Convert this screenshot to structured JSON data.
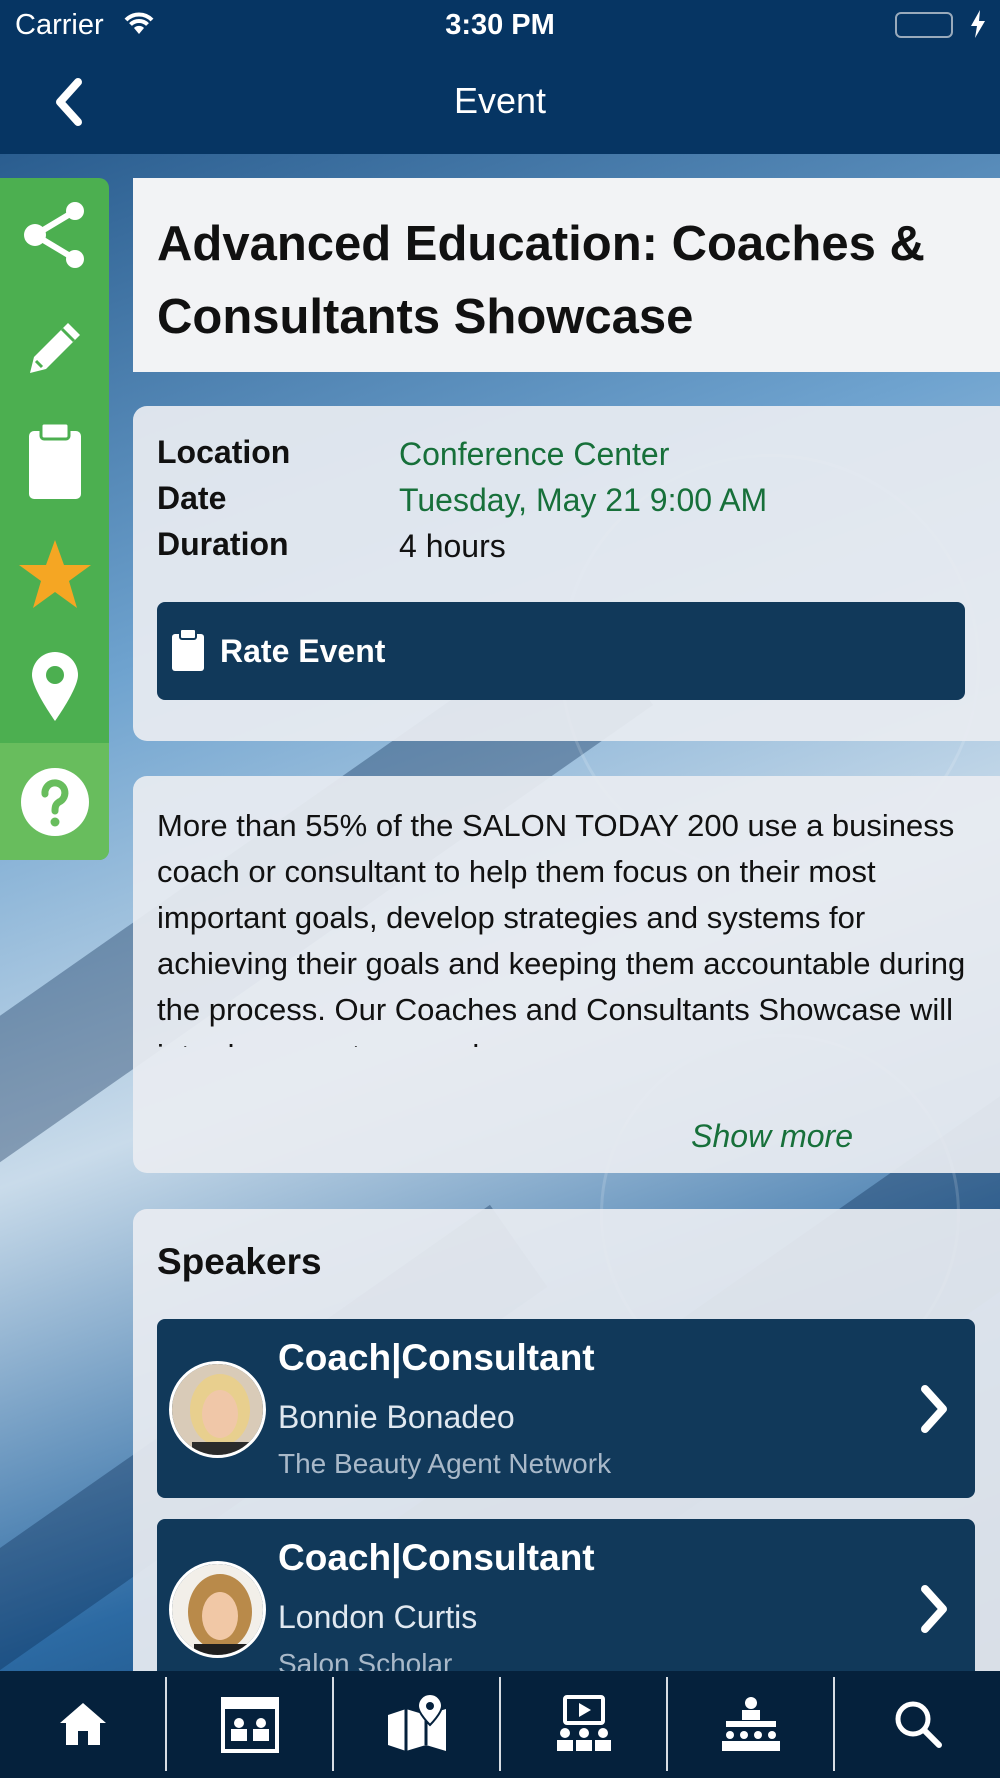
{
  "status_bar": {
    "carrier": "Carrier",
    "time": "3:30 PM"
  },
  "nav": {
    "title": "Event"
  },
  "event": {
    "title": "Advanced Education: Coaches & Consultants Showcase",
    "location_label": "Location",
    "location_value": "Conference Center",
    "date_label": "Date",
    "date_value": "Tuesday, May 21 9:00 AM",
    "duration_label": "Duration",
    "duration_value": "4 hours",
    "rate_button": "Rate Event",
    "description": "More than 55% of the SALON TODAY 200 use a business coach or consultant to help them focus on their most important goals, develop strategies and systems for achieving their goals and keeping them accountable during the process. Our Coaches and Consultants Showcase will introduce you to a number",
    "show_more": "Show more"
  },
  "speakers": {
    "heading": "Speakers",
    "items": [
      {
        "role": "Coach|Consultant",
        "name": "Bonnie Bonadeo",
        "org": "The Beauty Agent Network"
      },
      {
        "role": "Coach|Consultant",
        "name": "London Curtis",
        "org": "Salon Scholar"
      }
    ]
  },
  "rail_icons": [
    "share-icon",
    "pencil-icon",
    "clipboard-icon",
    "star-icon",
    "location-pin-icon",
    "help-icon"
  ],
  "tab_icons": [
    "home-icon",
    "exhibitors-icon",
    "map-icon",
    "sessions-icon",
    "speakers-icon",
    "search-icon"
  ],
  "colors": {
    "navy": "#063563",
    "green_rail": "#4caf50",
    "accent_green": "#17703a",
    "card_dark": "#11395a",
    "star": "#f5a623"
  }
}
